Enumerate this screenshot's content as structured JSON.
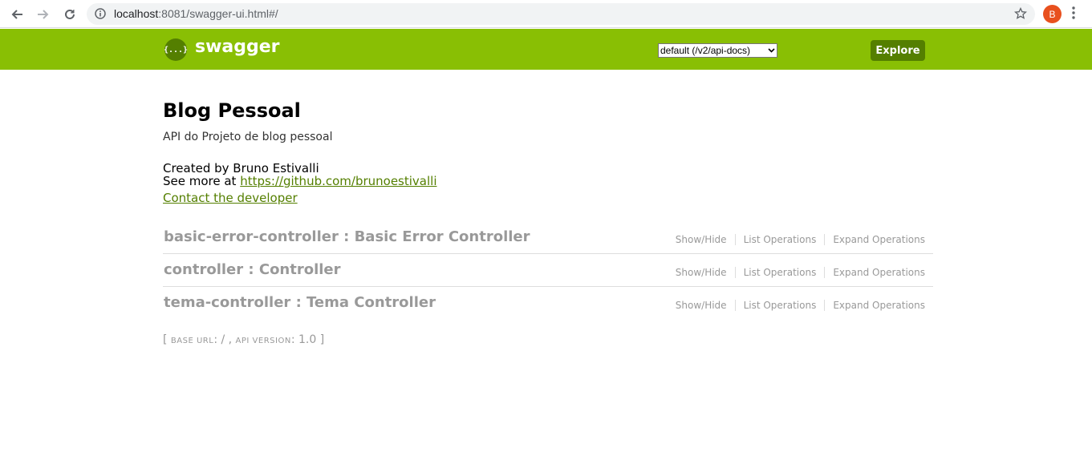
{
  "browser": {
    "url_host": "localhost",
    "url_rest": ":8081/swagger-ui.html#/",
    "profile_initial": "B"
  },
  "header": {
    "logo_symbol": "{...}",
    "logo_text": "swagger",
    "api_select_value": "default (/v2/api-docs)",
    "explore_label": "Explore",
    "colors": {
      "bar": "#89bf04",
      "button": "#547f00"
    }
  },
  "info": {
    "title": "Blog Pessoal",
    "description": "API do Projeto de blog pessoal",
    "created_by": "Created by Bruno Estivalli",
    "see_more_prefix": "See more at ",
    "see_more_link": "https://github.com/brunoestivalli",
    "contact": "Contact the developer"
  },
  "resources": [
    {
      "title": "basic-error-controller : Basic Error Controller"
    },
    {
      "title": "controller : Controller"
    },
    {
      "title": "tema-controller : Tema Controller"
    }
  ],
  "ops": {
    "show_hide": "Show/Hide",
    "list": "List Operations",
    "expand": "Expand Operations"
  },
  "footer": {
    "open": "[ ",
    "base_url_label": "base url",
    "base_url_value": ": / , ",
    "api_version_label": "api version",
    "api_version_value": ": 1.0 ]"
  }
}
